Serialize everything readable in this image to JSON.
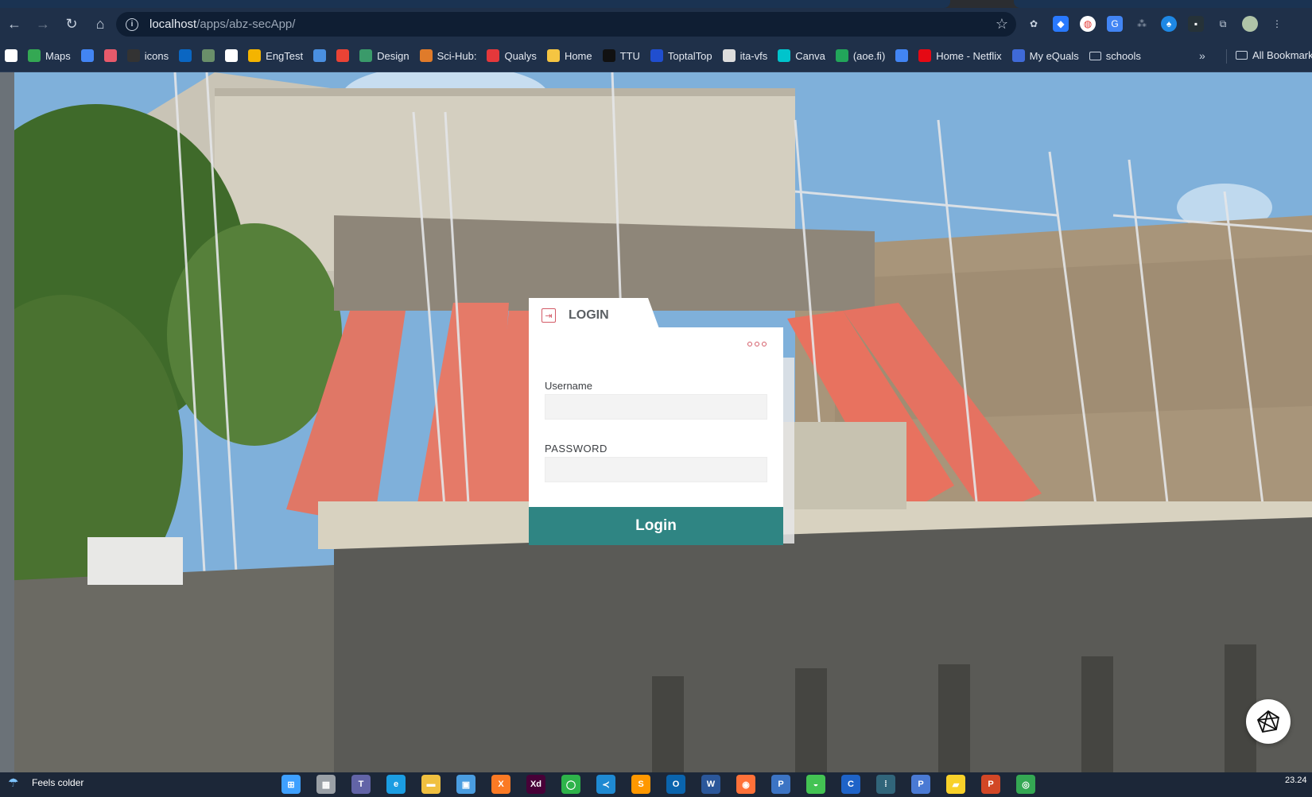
{
  "browser": {
    "url_host": "localhost",
    "url_path": "/apps/abz-secApp/",
    "bookmarks": [
      {
        "label": "",
        "icon": "square-icon",
        "color": "#ffffff"
      },
      {
        "label": "Maps",
        "icon": "maps-icon",
        "color": "#34a853"
      },
      {
        "label": "",
        "icon": "translate-icon",
        "color": "#4285f4"
      },
      {
        "label": "",
        "icon": "link-icon",
        "color": "#e85a6b"
      },
      {
        "label": "icons",
        "icon": "icons-icon",
        "color": "#333333"
      },
      {
        "label": "",
        "icon": "linkedin-icon",
        "color": "#0a66c2"
      },
      {
        "label": "",
        "icon": "bird-icon",
        "color": "#6a8f6a"
      },
      {
        "label": "",
        "icon": "google-icon",
        "color": "#ffffff"
      },
      {
        "label": "EngTest",
        "icon": "sun-icon",
        "color": "#f4b400"
      },
      {
        "label": "",
        "icon": "drop-icon",
        "color": "#4a8fe0"
      },
      {
        "label": "",
        "icon": "gmail-icon",
        "color": "#ea4335"
      },
      {
        "label": "Design",
        "icon": "design-icon",
        "color": "#3a9a6a"
      },
      {
        "label": "Sci-Hub:",
        "icon": "raven-icon",
        "color": "#e07b2a"
      },
      {
        "label": "Qualys",
        "icon": "qualys-icon",
        "color": "#e5383b"
      },
      {
        "label": "Home",
        "icon": "home-icon",
        "color": "#f5c542"
      },
      {
        "label": "TTU",
        "icon": "ttu-icon",
        "color": "#111111"
      },
      {
        "label": "ToptalTop",
        "icon": "toptal-icon",
        "color": "#204ecf"
      },
      {
        "label": "ita-vfs",
        "icon": "ita-icon",
        "color": "#dddddd"
      },
      {
        "label": "Canva",
        "icon": "canva-icon",
        "color": "#00c4cc"
      },
      {
        "label": "(aoe.fi)",
        "icon": "play-icon",
        "color": "#22a55a"
      },
      {
        "label": "",
        "icon": "doc-icon",
        "color": "#4285f4"
      },
      {
        "label": "Home - Netflix",
        "icon": "netflix-icon",
        "color": "#e50914"
      },
      {
        "label": "My eQuals",
        "icon": "equals-icon",
        "color": "#3f6ad8"
      },
      {
        "label": "schools",
        "icon": "folder-icon",
        "color": "#c9d3e0"
      }
    ],
    "more": "»",
    "all_bookmarks": "All Bookmarks"
  },
  "login": {
    "tab_title": "LOGIN",
    "username_label": "Username",
    "username_value": "",
    "password_label": "PASSWORD",
    "password_value": "",
    "button": "Login"
  },
  "taskbar": {
    "weather": "Feels colder",
    "time": "23.24",
    "apps": [
      {
        "name": "start-icon",
        "color": "#3ea0ff",
        "glyph": "⊞"
      },
      {
        "name": "explorer-icon",
        "color": "#9aa0a6",
        "glyph": "▦"
      },
      {
        "name": "teams-icon",
        "color": "#6264a7",
        "glyph": "T"
      },
      {
        "name": "edge-icon",
        "color": "#1b9de2",
        "glyph": "e"
      },
      {
        "name": "files-icon",
        "color": "#f0c040",
        "glyph": "▬"
      },
      {
        "name": "store-icon",
        "color": "#4a9de0",
        "glyph": "▣"
      },
      {
        "name": "xampp-icon",
        "color": "#fb7a24",
        "glyph": "X"
      },
      {
        "name": "xd-icon",
        "color": "#470137",
        "glyph": "Xd"
      },
      {
        "name": "refresh-icon",
        "color": "#2eb34a",
        "glyph": "◯"
      },
      {
        "name": "vscode-icon",
        "color": "#1f8ad2",
        "glyph": "≺"
      },
      {
        "name": "sublime-icon",
        "color": "#ff9800",
        "glyph": "S"
      },
      {
        "name": "outlook-icon",
        "color": "#0a64ad",
        "glyph": "O"
      },
      {
        "name": "word-icon",
        "color": "#2b579a",
        "glyph": "W"
      },
      {
        "name": "firefox-icon",
        "color": "#ff7139",
        "glyph": "◉"
      },
      {
        "name": "pycharm-icon",
        "color": "#3c74c4",
        "glyph": "P"
      },
      {
        "name": "frog-icon",
        "color": "#43c353",
        "glyph": "◒"
      },
      {
        "name": "c-icon",
        "color": "#1e63c8",
        "glyph": "C"
      },
      {
        "name": "cisco-icon",
        "color": "#31657a",
        "glyph": "⁞"
      },
      {
        "name": "pycharm2-icon",
        "color": "#4a7ad4",
        "glyph": "P"
      },
      {
        "name": "sticky-icon",
        "color": "#f8d12a",
        "glyph": "▰"
      },
      {
        "name": "powerpoint-icon",
        "color": "#d24726",
        "glyph": "P"
      },
      {
        "name": "chrome-icon",
        "color": "#34a853",
        "glyph": "◎"
      }
    ]
  }
}
